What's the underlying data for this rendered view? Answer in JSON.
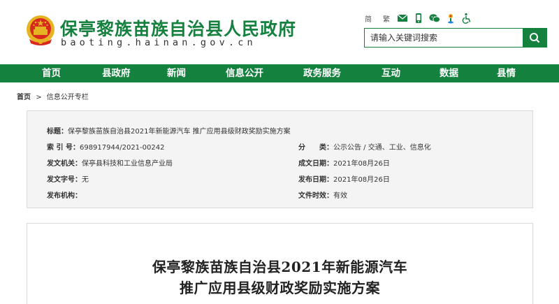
{
  "header": {
    "site_title": "保亭黎族苗族自治县人民政府",
    "site_domain": "baoting.hainan.gov.cn",
    "tools": {
      "simplified": "简",
      "traditional": "繁"
    },
    "search": {
      "placeholder": "请输入关键词搜索"
    }
  },
  "nav": {
    "items": [
      "首页",
      "县政府",
      "新闻",
      "信息公开",
      "政务服务",
      "互动",
      "数据",
      "县情"
    ]
  },
  "breadcrumb": {
    "home": "首页",
    "separator": ">",
    "current": "信息公开专栏"
  },
  "info": {
    "title_label": "标题：",
    "title_value": "保亭黎族苗族自治县2021年新能源汽车 推广应用县级财政奖励实施方案",
    "index_label": "索 引 号：",
    "index_value": "698917944/2021-00242",
    "category_label": "分　　类：",
    "category_value": "公示公告 / 交通、工业、信息化",
    "issuer_label": "发文机关：",
    "issuer_value": "保亭县科技和工业信息产业局",
    "created_label": "成文日期：",
    "created_value": "2021年08月26日",
    "docno_label": "发文字号：",
    "docno_value": "无",
    "published_label": "发布日期：",
    "published_value": "2021年08月26日",
    "publisher_label": "发布机构：",
    "publisher_value": "",
    "validity_label": "文件时效：",
    "validity_value": "有效"
  },
  "article": {
    "title_line1": "保亭黎族苗族自治县2021年新能源汽车",
    "title_line2": "推广应用县级财政奖励实施方案"
  },
  "colors": {
    "brand_green": "#15813f",
    "emblem_red": "#d62a1e",
    "emblem_gold": "#e6b422"
  }
}
